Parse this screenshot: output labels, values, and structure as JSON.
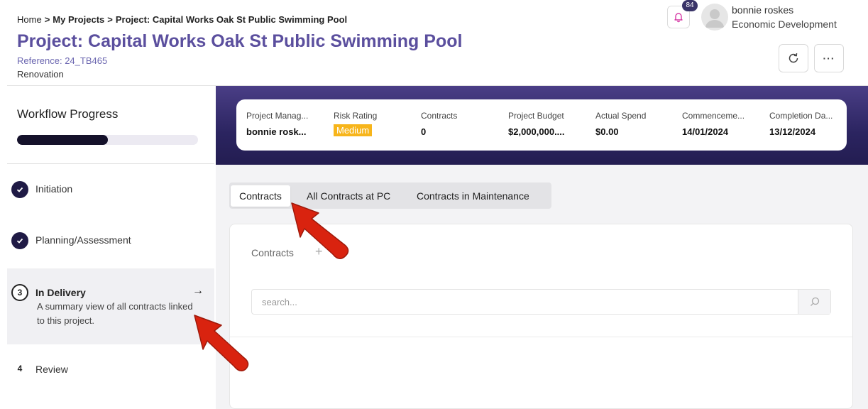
{
  "breadcrumb": {
    "home": "Home",
    "my_projects": "My Projects",
    "current": "Project: Capital Works Oak St Public Swimming Pool",
    "separator": ">"
  },
  "project": {
    "title": "Project: Capital Works Oak St Public Swimming Pool",
    "reference": "Reference: 24_TB465",
    "type": "Renovation"
  },
  "header": {
    "notification_count": "84",
    "user_name": "bonnie roskes",
    "user_department": "Economic Development",
    "refresh_icon": "refresh-icon",
    "more_icon": "more-horizontal-icon",
    "more_label": "···"
  },
  "workflow": {
    "title": "Workflow Progress",
    "progress": 0.5,
    "steps": [
      {
        "number": "1",
        "label": "Initiation",
        "state": "done"
      },
      {
        "number": "2",
        "label": "Planning/Assessment",
        "state": "done"
      },
      {
        "number": "3",
        "label": "In Delivery",
        "state": "current",
        "description": "A summary view of all contracts linked to this project."
      },
      {
        "number": "4",
        "label": "Review",
        "state": "todo"
      }
    ],
    "arrow": "→"
  },
  "summary": [
    {
      "label": "Project Manag...",
      "value": "bonnie rosk..."
    },
    {
      "label": "Risk Rating",
      "value": "Medium"
    },
    {
      "label": "Contracts",
      "value": "0"
    },
    {
      "label": "Project Budget",
      "value": "$2,000,000...."
    },
    {
      "label": "Actual Spend",
      "value": "$0.00"
    },
    {
      "label": "Commenceme...",
      "value": "14/01/2024"
    },
    {
      "label": "Completion Da...",
      "value": "13/12/2024"
    }
  ],
  "colors": {
    "title_purple": "#5b4f9e",
    "hero_dark": "#2b2460",
    "risk_medium": "#f7b51b",
    "annotation_red": "#d9230f"
  },
  "tabs": [
    {
      "label": "Contracts",
      "selected": true
    },
    {
      "label": "All Contracts at PC",
      "selected": false
    },
    {
      "label": "Contracts in Maintenance",
      "selected": false
    }
  ],
  "contracts_panel": {
    "title": "Contracts",
    "add_label": "+",
    "search_placeholder": "search..."
  }
}
